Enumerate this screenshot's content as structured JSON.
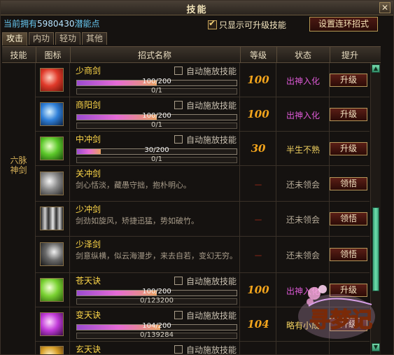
{
  "window": {
    "title": "技能",
    "close_label": "✕"
  },
  "points": {
    "prefix": "当前拥有",
    "value": "5980430",
    "suffix": "潜能点"
  },
  "filter": {
    "label": "只显示可升级技能",
    "checked": true
  },
  "combo_button": "设置连环招式",
  "tabs": [
    {
      "label": "攻击",
      "active": true
    },
    {
      "label": "内功",
      "active": false
    },
    {
      "label": "轻功",
      "active": false
    },
    {
      "label": "其他",
      "active": false
    }
  ],
  "columns": {
    "skill": "技能",
    "icon": "图标",
    "name": "招式名称",
    "level": "等级",
    "status": "状态",
    "upgrade": "提升"
  },
  "group": {
    "line1": "六脉",
    "line2": "神剑"
  },
  "rows": [
    {
      "name": "少商剑",
      "auto": "自动施放技能",
      "bar": "100/200",
      "fill": 0.5,
      "sub": "0/1",
      "level": "100",
      "status": "出神入化",
      "button": "升级",
      "icon": "red-sword-icon"
    },
    {
      "name": "商阳剑",
      "auto": "自动施放技能",
      "bar": "100/200",
      "fill": 0.5,
      "sub": "0/1",
      "level": "100",
      "status": "出神入化",
      "button": "升级",
      "icon": "blue-sword-icon"
    },
    {
      "name": "中冲剑",
      "auto": "自动施放技能",
      "bar": "30/200",
      "fill": 0.15,
      "sub": "0/1",
      "level": "30",
      "status": "半生不熟",
      "button": "升级",
      "icon": "green-sword-icon"
    },
    {
      "name": "关冲剑",
      "desc": "剑心恬淡，藏愚守拙，抱朴明心。",
      "level": "－",
      "status": "还未领会",
      "button": "领悟",
      "icon": "gray-sword-icon"
    },
    {
      "name": "少冲剑",
      "desc": "剑劲如旋风，矫捷迅猛，势如破竹。",
      "level": "－",
      "status": "还未领会",
      "button": "领悟",
      "icon": "gray-blades-icon"
    },
    {
      "name": "少泽剑",
      "desc": "剑意纵横，似云海漫步，来去自若，变幻无穷。",
      "level": "－",
      "status": "还未领会",
      "button": "领悟",
      "icon": "gray-sword-icon"
    },
    {
      "name": "苍天诀",
      "auto": "自动施放技能",
      "bar": "100/200",
      "fill": 0.5,
      "sub": "0/123200",
      "level": "100",
      "status": "出神入化",
      "button": "升级",
      "icon": "green-strike-icon"
    },
    {
      "name": "变天诀",
      "auto": "自动施放技能",
      "bar": "104/200",
      "fill": 0.52,
      "sub": "0/139284",
      "level": "104",
      "status": "略有小成",
      "button": "升级",
      "icon": "purple-strike-icon"
    },
    {
      "name": "玄天诀",
      "auto": "自动施放技能",
      "icon": "gold-strike-icon"
    }
  ],
  "logo_text": "寻梦记"
}
